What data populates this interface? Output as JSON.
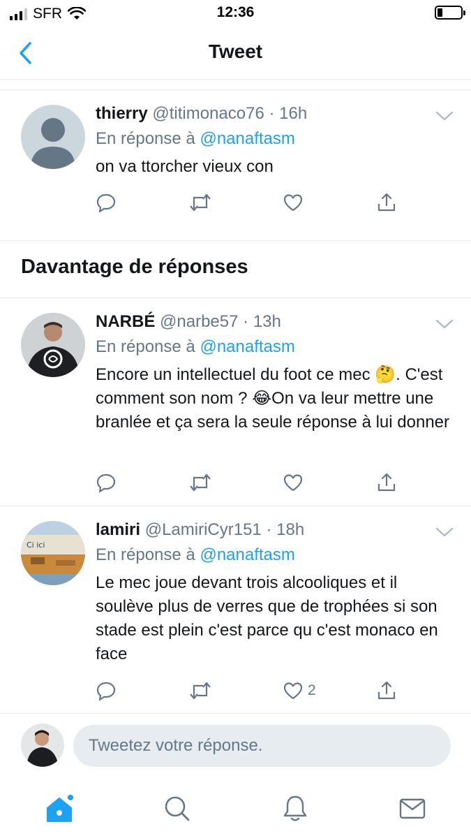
{
  "status_bar": {
    "carrier": "SFR",
    "time": "12:36"
  },
  "nav": {
    "title": "Tweet"
  },
  "colors": {
    "accent": "#1da1f2",
    "secondary_text": "#657786",
    "divider": "#e6ecf0"
  },
  "tweets": [
    {
      "name": "thierry",
      "handle": "@titimonaco76",
      "dot": "·",
      "time": "16h",
      "reply_prefix": "En réponse à",
      "reply_to": "@nanaftasm",
      "text": "on va ttorcher vieux con",
      "like_count": ""
    },
    {
      "name": "NARBÉ",
      "handle": "@narbe57",
      "dot": "·",
      "time": "13h",
      "reply_prefix": "En réponse à",
      "reply_to": "@nanaftasm",
      "text": "Encore un intellectuel du foot ce mec 🤔. C'est comment son nom ? 😂On va leur mettre une branlée et ça sera la seule réponse à lui donner",
      "like_count": ""
    },
    {
      "name": "lamiri",
      "handle": "@LamiriCyr151",
      "dot": "·",
      "time": "18h",
      "reply_prefix": "En réponse à",
      "reply_to": "@nanaftasm",
      "text": "Le mec joue devant trois alcooliques et il soulève plus de verres que de trophées si son stade est plein c'est parce qu c'est monaco en face",
      "like_count": "2"
    }
  ],
  "section": {
    "title": "Davantage de réponses"
  },
  "reply_box": {
    "placeholder": "Tweetez votre réponse."
  },
  "tabs": [
    "home-icon",
    "search-icon",
    "notifications-icon",
    "messages-icon"
  ]
}
